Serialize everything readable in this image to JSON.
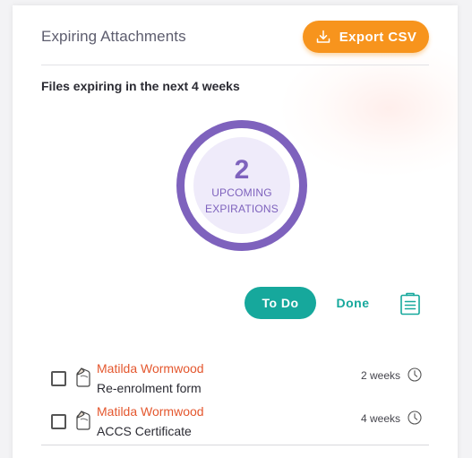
{
  "widget": {
    "title": "Expiring Attachments",
    "export_label": "Export CSV",
    "subtitle": "Files expiring in the next 4 weeks"
  },
  "summary": {
    "count": "2",
    "label_line1": "UPCOMING",
    "label_line2": "EXPIRATIONS"
  },
  "filters": {
    "todo_label": "To Do",
    "done_label": "Done",
    "active": "To Do"
  },
  "items": [
    {
      "name": "Matilda Wormwood",
      "document": "Re-enrolment form",
      "due": "2 weeks",
      "checked": false
    },
    {
      "name": "Matilda Wormwood",
      "document": "ACCS Certificate",
      "due": "4 weeks",
      "checked": false
    }
  ],
  "icons": {
    "export": "download-icon",
    "clipboard": "clipboard-list-icon",
    "file": "attachment-file-icon",
    "due": "clock-icon"
  },
  "colors": {
    "accent_orange": "#f7941d",
    "accent_teal": "#16a89c",
    "ring_purple": "#7e62bd",
    "ring_fill": "#efebfa",
    "name_orange": "#e4572e"
  }
}
